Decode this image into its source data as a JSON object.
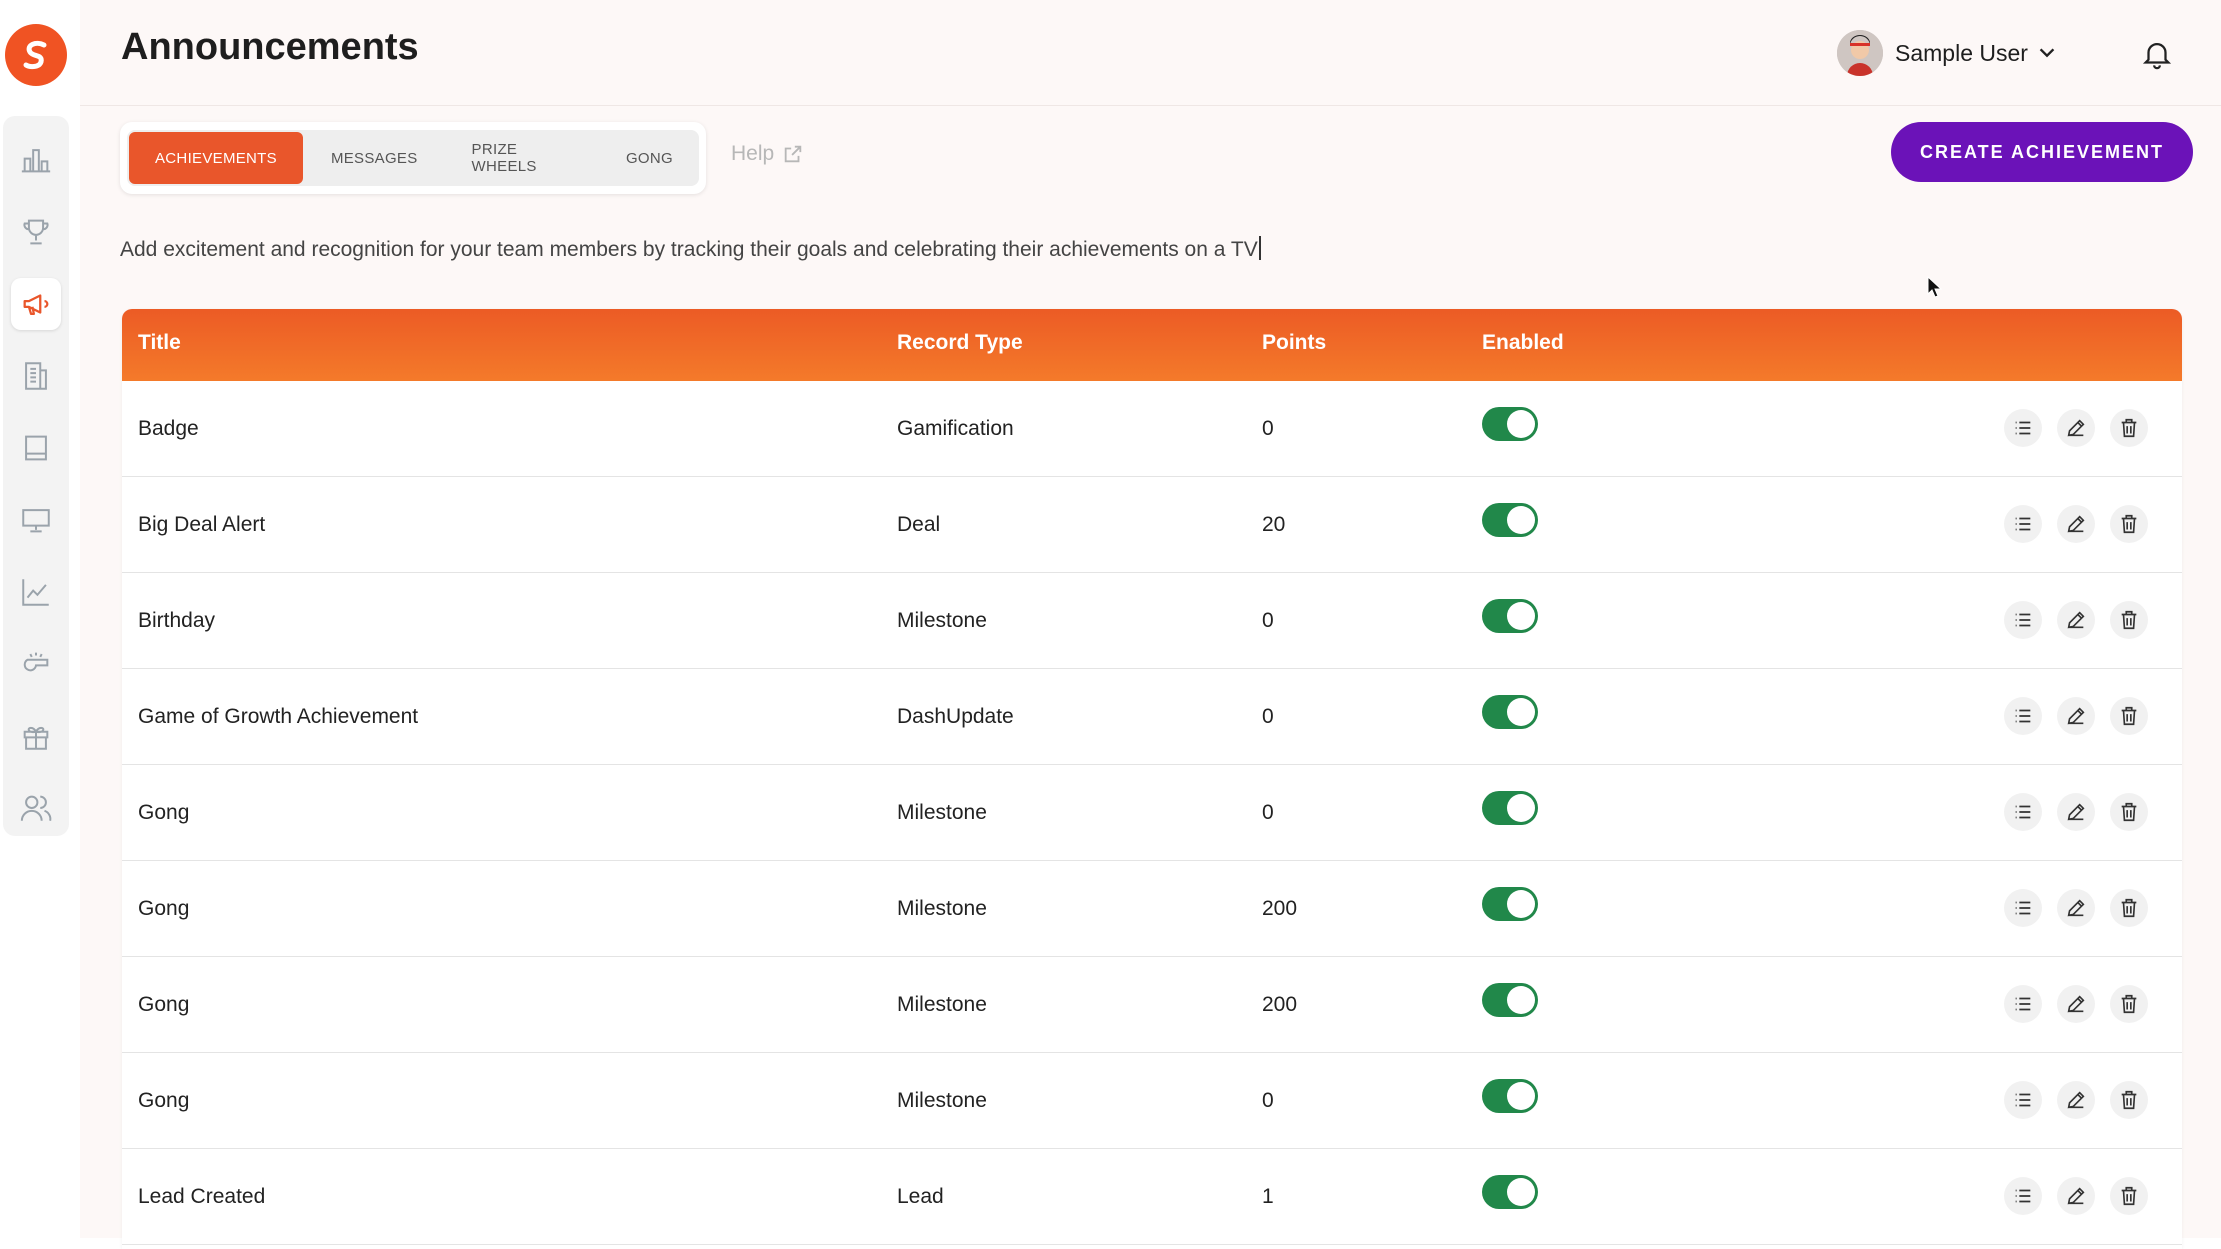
{
  "app": {
    "brand_color": "#f05323",
    "accent_color": "#6b12b8",
    "toggle_on_color": "#21884a"
  },
  "header": {
    "title": "Announcements",
    "user_name": "Sample User",
    "bell_icon": "bell-icon"
  },
  "sidebar": {
    "items": [
      {
        "name": "leaderboard",
        "icon": "bar-chart-icon",
        "active": false
      },
      {
        "name": "competitions",
        "icon": "trophy-icon",
        "active": false
      },
      {
        "name": "announcements",
        "icon": "megaphone-icon",
        "active": true
      },
      {
        "name": "reports",
        "icon": "report-icon",
        "active": false
      },
      {
        "name": "feed",
        "icon": "book-icon",
        "active": false
      },
      {
        "name": "tv",
        "icon": "monitor-icon",
        "active": false
      },
      {
        "name": "analytics",
        "icon": "line-chart-icon",
        "active": false
      },
      {
        "name": "whistle",
        "icon": "whistle-icon",
        "active": false
      },
      {
        "name": "rewards",
        "icon": "gift-icon",
        "active": false
      },
      {
        "name": "users",
        "icon": "users-icon",
        "active": false
      }
    ]
  },
  "tabs": [
    {
      "label": "ACHIEVEMENTS",
      "active": true
    },
    {
      "label": "MESSAGES",
      "active": false
    },
    {
      "label": "PRIZE WHEELS",
      "active": false
    },
    {
      "label": "GONG",
      "active": false
    }
  ],
  "help_label": "Help",
  "create_button_label": "CREATE ACHIEVEMENT",
  "description": "Add excitement and recognition for your team members by tracking their goals and celebrating their achievements on a TV",
  "table": {
    "headers": {
      "title": "Title",
      "record_type": "Record Type",
      "points": "Points",
      "enabled": "Enabled"
    },
    "rows": [
      {
        "title": "Badge",
        "record_type": "Gamification",
        "points": "0",
        "enabled": true
      },
      {
        "title": "Big Deal Alert",
        "record_type": "Deal",
        "points": "20",
        "enabled": true
      },
      {
        "title": "Birthday",
        "record_type": "Milestone",
        "points": "0",
        "enabled": true
      },
      {
        "title": "Game of Growth Achievement",
        "record_type": "DashUpdate",
        "points": "0",
        "enabled": true
      },
      {
        "title": "Gong",
        "record_type": "Milestone",
        "points": "0",
        "enabled": true
      },
      {
        "title": "Gong",
        "record_type": "Milestone",
        "points": "200",
        "enabled": true
      },
      {
        "title": "Gong",
        "record_type": "Milestone",
        "points": "200",
        "enabled": true
      },
      {
        "title": "Gong",
        "record_type": "Milestone",
        "points": "0",
        "enabled": true
      },
      {
        "title": "Lead Created",
        "record_type": "Lead",
        "points": "1",
        "enabled": true
      }
    ]
  }
}
